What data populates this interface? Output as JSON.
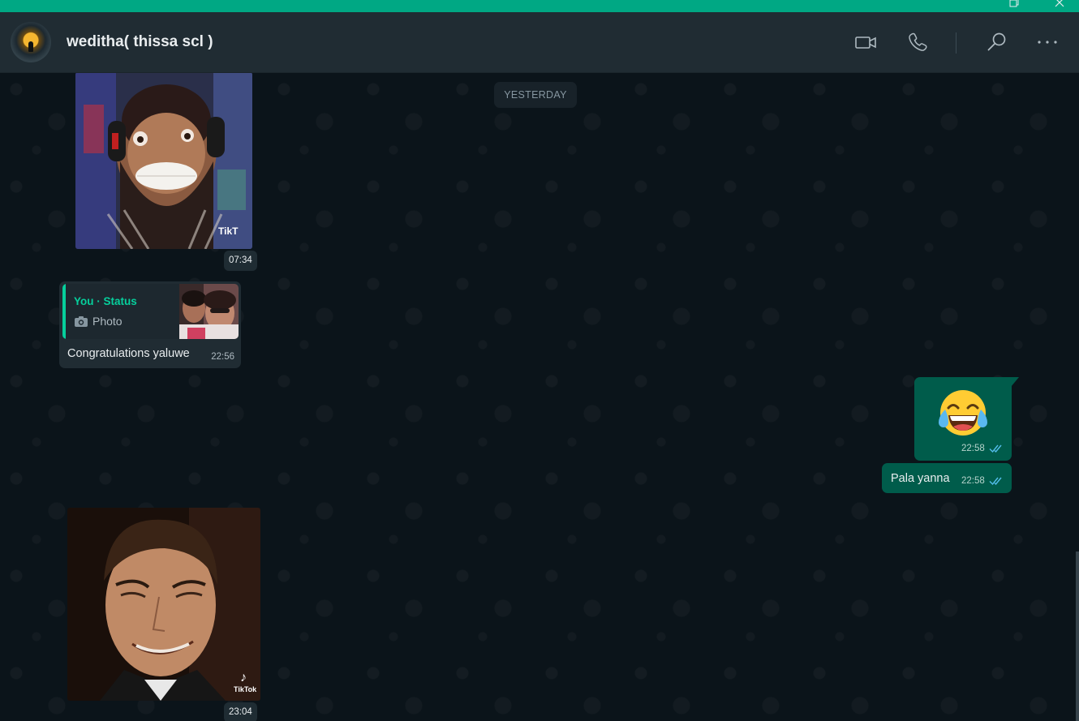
{
  "window": {
    "accent_color": "#00a884"
  },
  "header": {
    "contact_name": "weditha( thissa scl )",
    "icons": [
      "video-call-icon",
      "voice-call-icon",
      "search-icon",
      "more-options-icon"
    ]
  },
  "chat": {
    "date_separator": "YESTERDAY",
    "messages": [
      {
        "direction": "incoming",
        "type": "media",
        "time": "07:34",
        "watermark": "TikT"
      },
      {
        "direction": "incoming",
        "type": "status-reply",
        "quote_author": "You · Status",
        "quote_type": "Photo",
        "text": "Congratulations yaluwe",
        "time": "22:56"
      },
      {
        "direction": "outgoing",
        "type": "emoji",
        "emoji": "😂",
        "time": "22:58",
        "status": "read"
      },
      {
        "direction": "outgoing",
        "type": "text",
        "text": "Pala yanna",
        "time": "22:58",
        "status": "read"
      },
      {
        "direction": "incoming",
        "type": "media",
        "time": "23:04",
        "watermark": "TikTok"
      }
    ]
  },
  "colors": {
    "outgoing_bubble": "#005c4b",
    "incoming_bubble": "#202c33",
    "read_ticks": "#53bdeb"
  }
}
